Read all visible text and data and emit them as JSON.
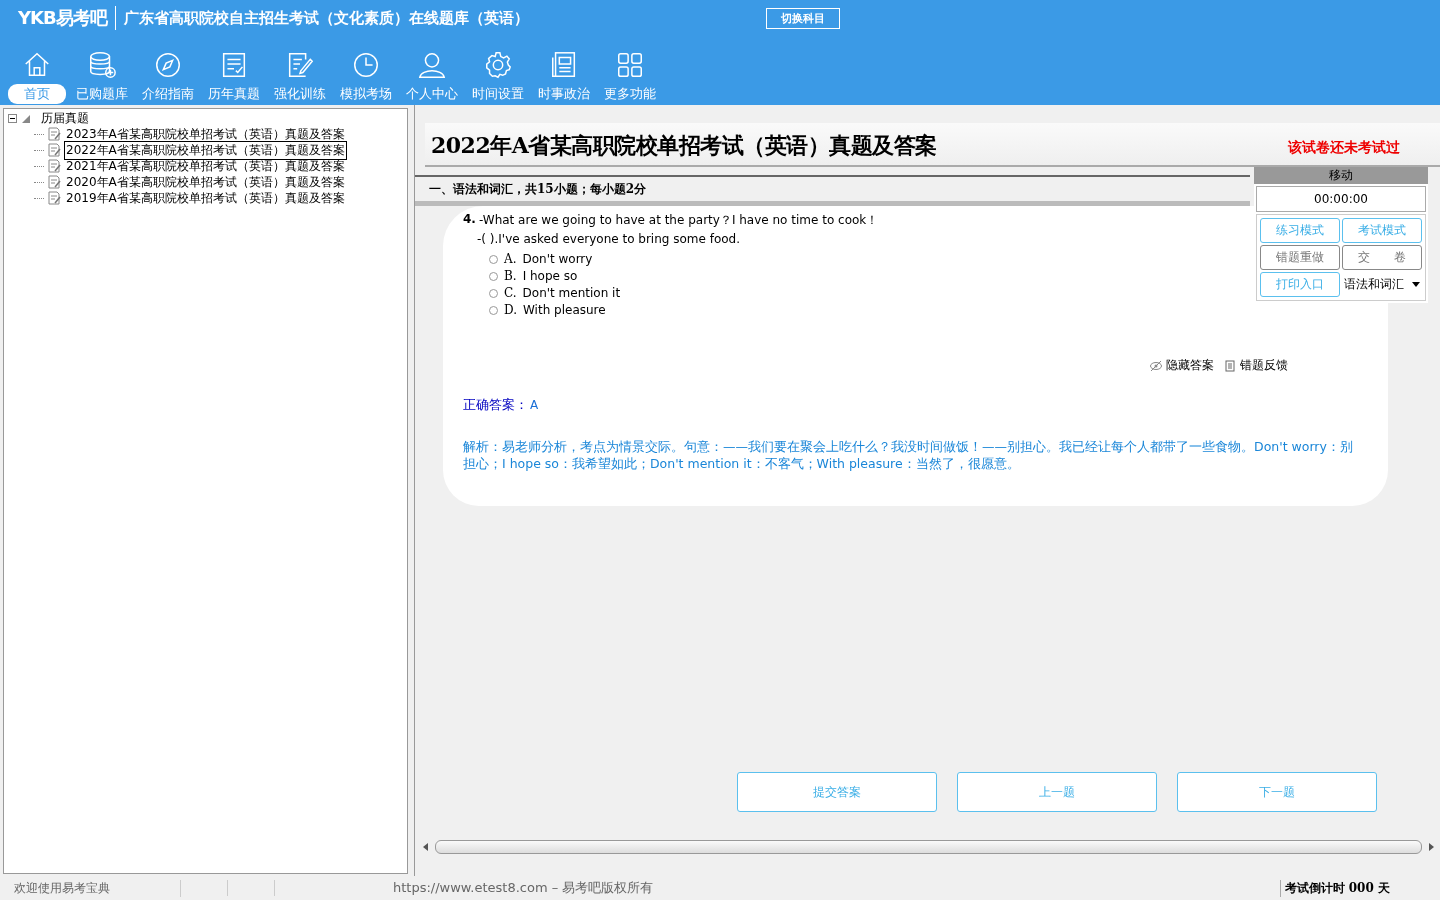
{
  "header": {
    "logo": "YKB易考吧",
    "title": "广东省高职院校自主招生考试（文化素质）在线题库（英语）",
    "switch_button": "切换科目"
  },
  "nav": [
    {
      "kind": "home",
      "label": "首页",
      "selected": true
    },
    {
      "kind": "database",
      "label": "已购题库",
      "selected": false
    },
    {
      "kind": "compass",
      "label": "介绍指南",
      "selected": false
    },
    {
      "kind": "list",
      "label": "历年真题",
      "selected": false
    },
    {
      "kind": "edit",
      "label": "强化训练",
      "selected": false
    },
    {
      "kind": "clock",
      "label": "模拟考场",
      "selected": false
    },
    {
      "kind": "user",
      "label": "个人中心",
      "selected": false
    },
    {
      "kind": "gear",
      "label": "时间设置",
      "selected": false
    },
    {
      "kind": "news",
      "label": "时事政治",
      "selected": false
    },
    {
      "kind": "grid",
      "label": "更多功能",
      "selected": false
    }
  ],
  "tree": {
    "label": "历届真题",
    "expanded": true,
    "children": [
      {
        "label": "2023年A省某高职院校单招考试（英语）真题及答案",
        "selected": false
      },
      {
        "label": "2022年A省某高职院校单招考试（英语）真题及答案",
        "selected": true
      },
      {
        "label": "2021年A省某高职院校单招考试（英语）真题及答案",
        "selected": false
      },
      {
        "label": "2020年A省某高职院校单招考试（英语）真题及答案",
        "selected": false
      },
      {
        "label": "2019年A省某高职院校单招考试（英语）真题及答案",
        "selected": false
      }
    ]
  },
  "paper": {
    "title": "2022年A省某高职院校单招考试（英语）真题及答案",
    "status_note": "该试卷还未考试过",
    "section": "一、语法和词汇，共15小题；每小题2分"
  },
  "question": {
    "number": "4.",
    "lines": [
      "-What are we going to have at the party？I have no time to cook！",
      "-(  ).I've asked everyone to bring some food."
    ],
    "options": [
      {
        "letter": "A.",
        "text": "Don't worry",
        "selected": false
      },
      {
        "letter": "B.",
        "text": "I hope so",
        "selected": false
      },
      {
        "letter": "C.",
        "text": "Don't mention it",
        "selected": false
      },
      {
        "letter": "D.",
        "text": "With pleasure",
        "selected": false
      }
    ],
    "hide_answer": "隐藏答案",
    "feedback": "错题反馈",
    "answer_label": "正确答案：",
    "answer_value": "A",
    "analysis": "解析：易老师分析，考点为情景交际。句意：——我们要在聚会上吃什么？我没时间做饭！——别担心。我已经让每个人都带了一些食物。Don't worry：别担心；I hope so：我希望如此；Don't mention it：不客气；With pleasure：当然了，很愿意。"
  },
  "side_panel": {
    "handle": "移动",
    "timer": "00:00:00",
    "buttons": [
      {
        "label": "练习模式",
        "kind": "blue"
      },
      {
        "label": "考试模式",
        "kind": "blue"
      },
      {
        "label": "错题重做",
        "kind": "grey"
      },
      {
        "label": "交　　卷",
        "kind": "grey"
      },
      {
        "label": "打印入口",
        "kind": "blue"
      }
    ],
    "dropdown": "语法和词汇"
  },
  "bottom_buttons": [
    "提交答案",
    "上一题",
    "下一题"
  ],
  "status_bar": {
    "welcome": "欢迎使用易考宝典",
    "copyright": "https://www.etest8.com – 易考吧版权所有",
    "countdown": "考试倒计时 000 天"
  }
}
